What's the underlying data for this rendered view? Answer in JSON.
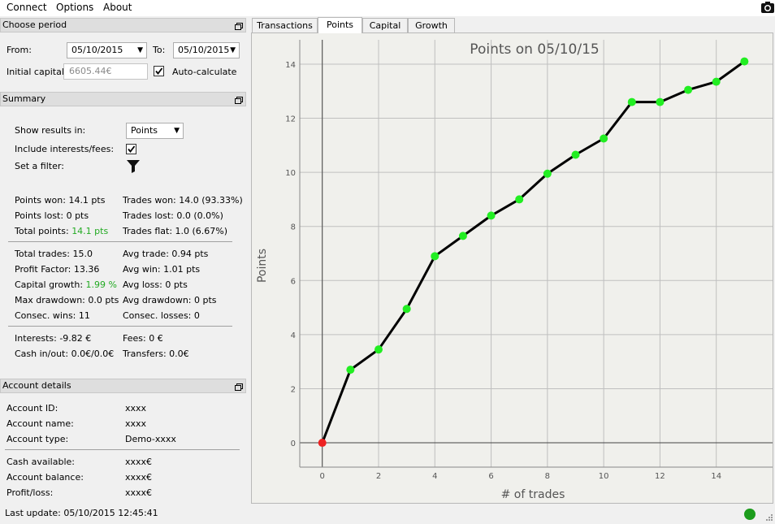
{
  "menu": {
    "connect": "Connect",
    "options": "Options",
    "about": "About"
  },
  "period": {
    "title": "Choose period",
    "from_label": "From:",
    "from_value": "05/10/2015",
    "to_label": "To:",
    "to_value": "05/10/2015",
    "initial_capital_label": "Initial capital:",
    "initial_capital_value": "6605.44€",
    "auto_calculate_label": "Auto-calculate"
  },
  "summary": {
    "title": "Summary",
    "show_results_label": "Show results in:",
    "show_results_value": "Points",
    "include_interests_label": "Include interests/fees:",
    "filter_label": "Set a filter:",
    "points_won": "Points won: 14.1 pts",
    "trades_won": "Trades won: 14.0 (93.33%)",
    "points_lost": "Points lost: 0 pts",
    "trades_lost": "Trades lost: 0.0 (0.0%)",
    "total_points_label": "Total points:",
    "total_points_value": "14.1 pts",
    "trades_flat": "Trades flat: 1.0 (6.67%)",
    "total_trades": "Total trades: 15.0",
    "avg_trade": "Avg trade: 0.94 pts",
    "profit_factor": "Profit Factor: 13.36",
    "avg_win": "Avg win: 1.01 pts",
    "capital_growth_label": "Capital growth:",
    "capital_growth_value": "1.99 %",
    "avg_loss": "Avg loss: 0 pts",
    "max_drawdown": "Max drawdown: 0.0 pts",
    "avg_drawdown": "Avg drawdown: 0 pts",
    "consec_wins": "Consec. wins: 11",
    "consec_losses": "Consec. losses: 0",
    "interests": "Interests: -9.82 €",
    "fees": "Fees: 0 €",
    "cash_inout": "Cash in/out: 0.0€/0.0€",
    "transfers": "Transfers: 0.0€"
  },
  "account": {
    "title": "Account details",
    "id_label": "Account ID:",
    "id_value": "xxxx",
    "name_label": "Account name:",
    "name_value": "xxxx",
    "type_label": "Account type:",
    "type_value": "Demo-xxxx",
    "cash_label": "Cash available:",
    "cash_value": "xxxx€",
    "balance_label": "Account balance:",
    "balance_value": "xxxx€",
    "pl_label": "Profit/loss:",
    "pl_value": "xxxx€"
  },
  "tabs": [
    "Transactions",
    "Points",
    "Capital",
    "Growth"
  ],
  "active_tab": "Points",
  "status": {
    "last_update": "Last update: 05/10/2015 12:45:41",
    "connection_color": "#1c9c1c"
  },
  "chart_data": {
    "type": "line",
    "title": "Points on 05/10/15",
    "xlabel": "# of trades",
    "ylabel": "Points",
    "x": [
      0,
      1,
      2,
      3,
      4,
      5,
      6,
      7,
      8,
      9,
      10,
      11,
      12,
      13,
      14,
      15
    ],
    "values": [
      0,
      2.7,
      3.45,
      4.95,
      6.9,
      7.65,
      8.4,
      9.0,
      9.95,
      10.65,
      11.25,
      12.6,
      12.6,
      13.05,
      13.35,
      14.1
    ],
    "xlim": [
      -0.8,
      16
    ],
    "ylim": [
      -0.9,
      14.9
    ],
    "xticks": [
      0,
      2,
      4,
      6,
      8,
      10,
      12,
      14
    ],
    "yticks": [
      0,
      2,
      4,
      6,
      8,
      10,
      12,
      14
    ],
    "grid": true,
    "line_color": "#000000",
    "point_color": "#22ee22",
    "first_point_color": "#ee2222"
  }
}
